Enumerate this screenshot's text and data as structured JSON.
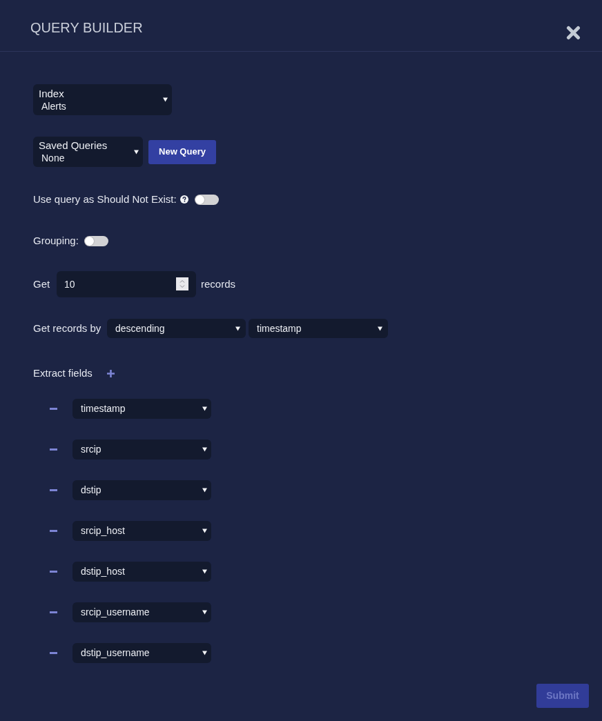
{
  "header": {
    "title": "QUERY BUILDER"
  },
  "index_select": {
    "label": "Index",
    "value": "Alerts"
  },
  "saved_queries": {
    "label": "Saved Queries",
    "value": "None",
    "button": "New Query"
  },
  "should_not_exist": {
    "label": "Use query as Should Not Exist:",
    "on": false
  },
  "grouping": {
    "label": "Grouping:",
    "on": false
  },
  "get_records": {
    "prefix": "Get",
    "value": "10",
    "suffix": "records"
  },
  "sort": {
    "label": "Get records by",
    "order": "descending",
    "field": "timestamp"
  },
  "extract_fields": {
    "label": "Extract fields",
    "fields": [
      "timestamp",
      "srcip",
      "dstip",
      "srcip_host",
      "dstip_host",
      "srcip_username",
      "dstip_username"
    ]
  },
  "submit_button": {
    "label": "Submit",
    "disabled": true
  }
}
